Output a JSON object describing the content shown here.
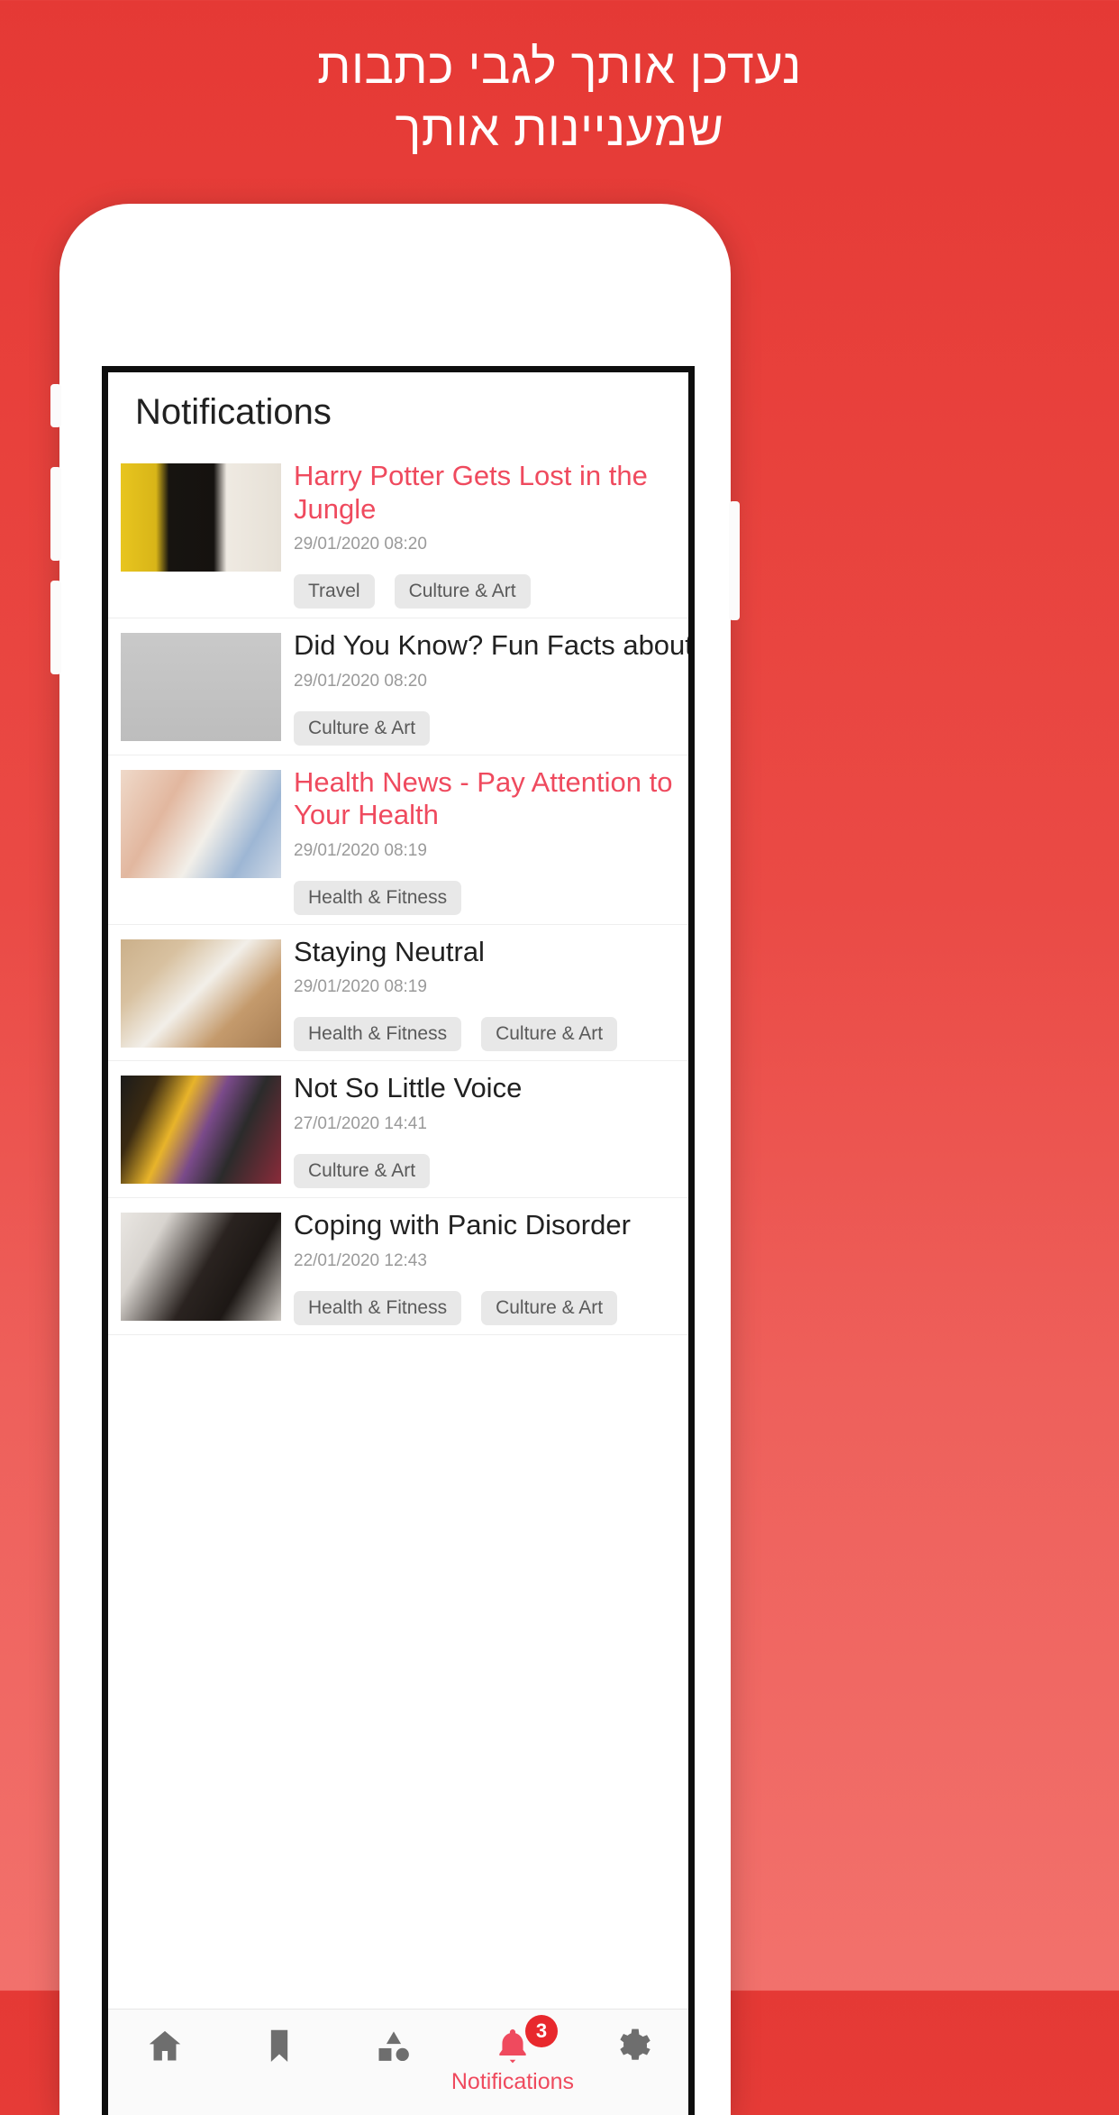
{
  "headline": {
    "line1": "נעדכן אותך לגבי כתבות",
    "line2": "שמעניינות אותך"
  },
  "colors": {
    "background_red": "#e8413c",
    "accent_pink": "#ef4a5e",
    "badge_red": "#e8282d",
    "tag_bg": "#e8e8e8",
    "tag_text": "#5a5a5a",
    "time_text": "#9a9a9a",
    "title_text": "#212121",
    "nav_inactive": "#6e6e6e"
  },
  "app": {
    "title": "Notifications",
    "notifications": [
      {
        "title": "Harry Potter Gets Lost in the Jungle",
        "time": "29/01/2020 08:20",
        "unread": true,
        "tags": [
          "Travel",
          "Culture & Art"
        ],
        "image": "harry-potter-actor-portrait"
      },
      {
        "title": "Did You Know? Fun Facts about Popcorn",
        "time": "29/01/2020 08:20",
        "unread": false,
        "tags": [
          "Culture & Art"
        ],
        "image": "couple-with-popcorn"
      },
      {
        "title": "Health News - Pay Attention to Your Health",
        "time": "29/01/2020 08:19",
        "unread": true,
        "tags": [
          "Health & Fitness"
        ],
        "image": "couple-eating-donuts"
      },
      {
        "title": "Staying Neutral",
        "time": "29/01/2020 08:19",
        "unread": false,
        "tags": [
          "Health & Fitness",
          "Culture & Art"
        ],
        "image": "gift-box-with-rainbow-ribbon"
      },
      {
        "title": "Not So Little Voice",
        "time": "27/01/2020 14:41",
        "unread": false,
        "tags": [
          "Culture & Art"
        ],
        "image": "hands-playing-piano"
      },
      {
        "title": "Coping with Panic Disorder",
        "time": "22/01/2020 12:43",
        "unread": false,
        "tags": [
          "Health & Fitness",
          "Culture & Art"
        ],
        "image": "person-covering-face-distress"
      }
    ],
    "nav": [
      {
        "icon": "home-icon",
        "label": "",
        "active": false,
        "badge": ""
      },
      {
        "icon": "bookmark-icon",
        "label": "",
        "active": false,
        "badge": ""
      },
      {
        "icon": "shapes-icon",
        "label": "",
        "active": false,
        "badge": ""
      },
      {
        "icon": "bell-icon",
        "label": "Notifications",
        "active": true,
        "badge": "3"
      },
      {
        "icon": "gear-icon",
        "label": "",
        "active": false,
        "badge": ""
      }
    ]
  }
}
